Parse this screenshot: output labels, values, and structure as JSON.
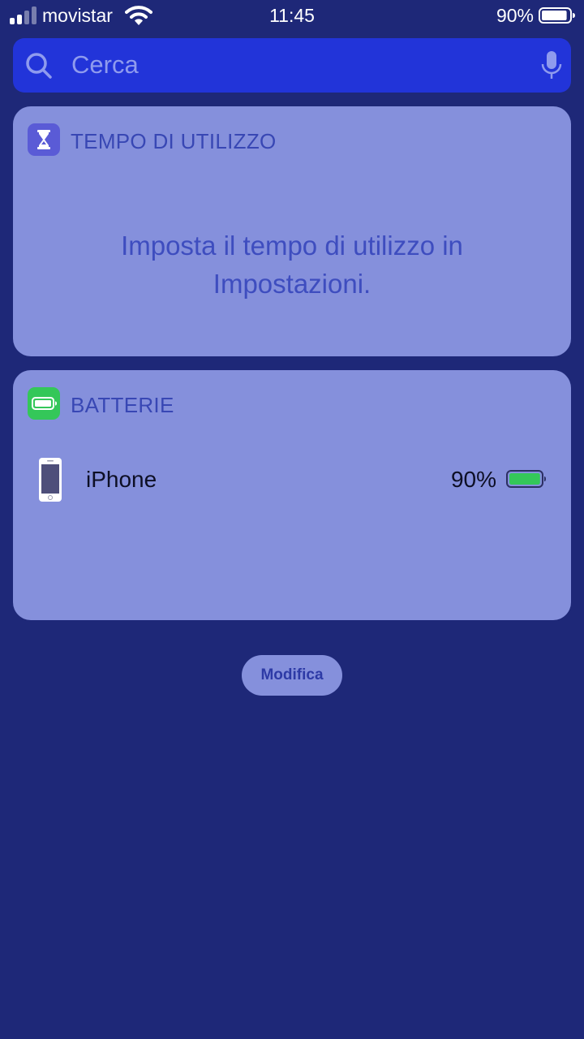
{
  "status_bar": {
    "carrier": "movistar",
    "time": "11:45",
    "battery_percent": "90%",
    "battery_level": 0.9,
    "signal_bars_filled": 2,
    "signal_bars_total": 4
  },
  "search": {
    "placeholder": "Cerca",
    "icons": [
      "search-icon",
      "microphone-icon"
    ]
  },
  "widgets": {
    "screen_time": {
      "title": "TEMPO DI UTILIZZO",
      "icon": "hourglass-icon",
      "message": "Imposta il tempo di utilizzo in Impostazioni."
    },
    "batteries": {
      "title": "BATTERIE",
      "icon": "battery-icon",
      "devices": [
        {
          "name": "iPhone",
          "percent": "90%",
          "level": 0.9,
          "icon": "iphone-icon"
        }
      ]
    }
  },
  "edit_button": {
    "label": "Modifica"
  },
  "colors": {
    "background": "#1e2878",
    "search_bg": "#2234d9",
    "widget_bg": "#8590dc",
    "widget_title": "#3847b4",
    "screen_time_icon_bg": "#5a5bd6",
    "batteries_icon_bg": "#34c759",
    "battery_fill": "#34c759"
  }
}
